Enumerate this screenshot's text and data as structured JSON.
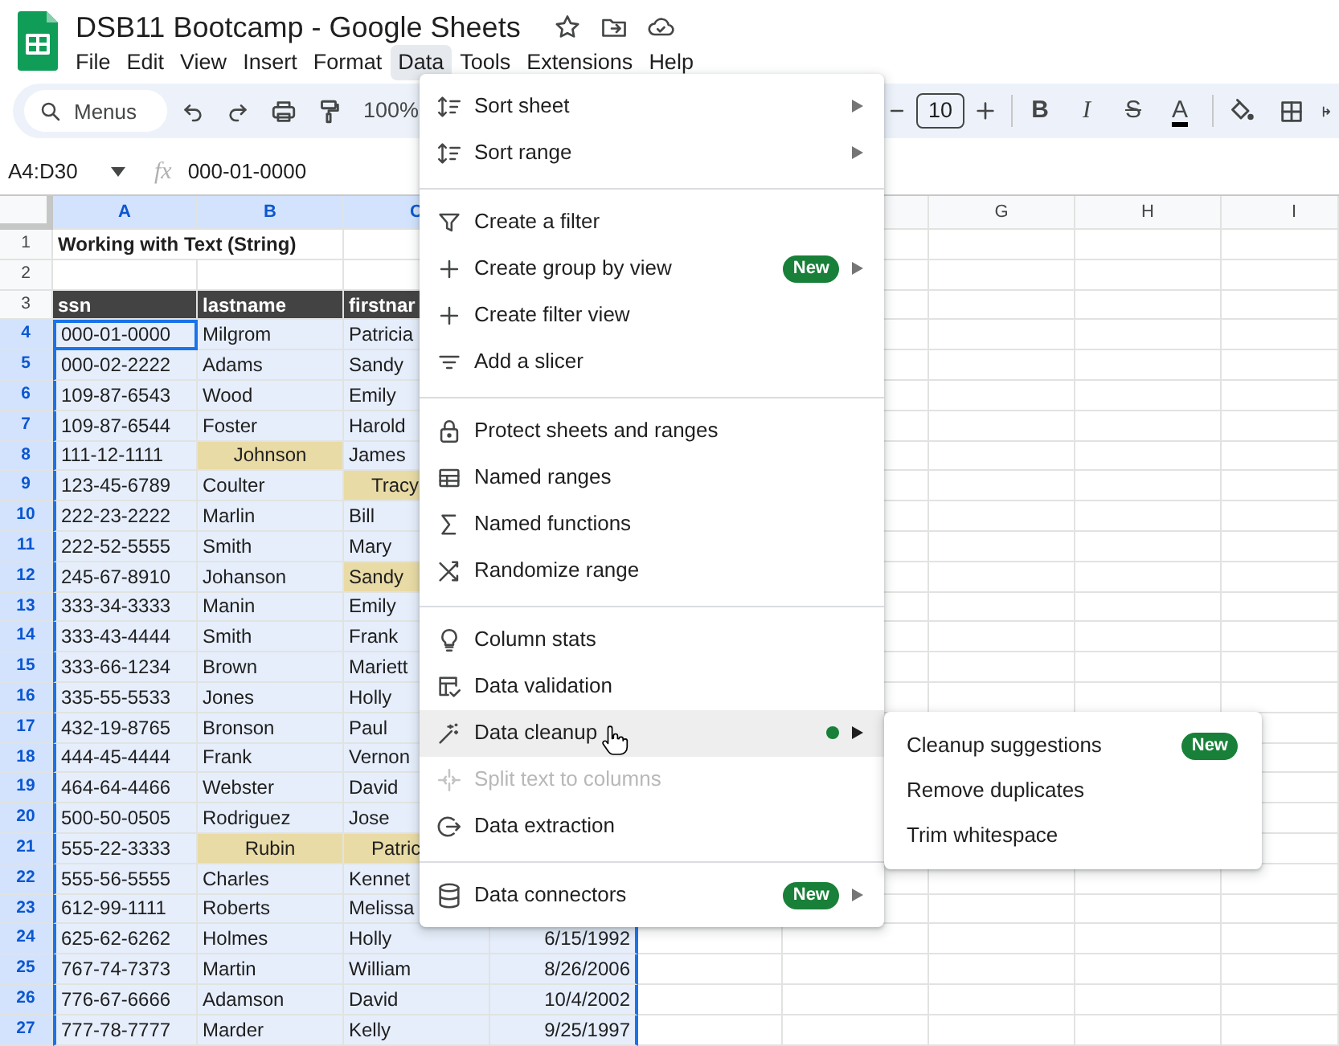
{
  "window": {
    "title": "DSB11 Bootcamp - Google Sheets"
  },
  "menu_bar": [
    {
      "label": "File",
      "selected": false
    },
    {
      "label": "Edit",
      "selected": false
    },
    {
      "label": "View",
      "selected": false
    },
    {
      "label": "Insert",
      "selected": false
    },
    {
      "label": "Format",
      "selected": false
    },
    {
      "label": "Data",
      "selected": true
    },
    {
      "label": "Tools",
      "selected": false
    },
    {
      "label": "Extensions",
      "selected": false
    },
    {
      "label": "Help",
      "selected": false
    }
  ],
  "toolbar": {
    "search": {
      "placeholder": "Menus"
    },
    "zoom": "100%",
    "font_size": "10",
    "format_buttons": [
      {
        "kind": "bold",
        "label": "B"
      },
      {
        "kind": "italic",
        "label": "I"
      },
      {
        "kind": "strikethrough",
        "label": "S"
      },
      {
        "kind": "text_color",
        "label": "A"
      }
    ]
  },
  "formula_bar": {
    "name_box": "A4:D30",
    "fx_label": "fx",
    "formula": "000-01-0000"
  },
  "sheet": {
    "columns": [
      {
        "label": "A",
        "selected": true
      },
      {
        "label": "B",
        "selected": true
      },
      {
        "label": "C",
        "selected": true
      },
      {
        "label": "G",
        "selected": false
      },
      {
        "label": "H",
        "selected": false
      },
      {
        "label": "I",
        "selected": false
      }
    ],
    "rows": [
      {
        "number": "1",
        "kind": "title",
        "selected": false,
        "cells": [
          {
            "text": "Working with Text (String)",
            "kind": "text"
          }
        ]
      },
      {
        "number": "2",
        "kind": "data",
        "selected": false
      },
      {
        "number": "3",
        "kind": "header",
        "selected": false,
        "cells": [
          {
            "text": "ssn",
            "kind": "text"
          },
          {
            "text": "lastname",
            "kind": "text"
          },
          {
            "text": "firstnar",
            "kind": "text"
          }
        ]
      },
      {
        "number": "4",
        "kind": "data",
        "selected": true,
        "cells": [
          {
            "text": "000-01-0000",
            "kind": "active"
          },
          {
            "text": "Milgrom",
            "kind": "text"
          },
          {
            "text": "Patricia",
            "kind": "text"
          }
        ]
      },
      {
        "number": "5",
        "kind": "data",
        "selected": true,
        "cells": [
          {
            "text": "000-02-2222",
            "kind": "text"
          },
          {
            "text": "Adams",
            "kind": "text"
          },
          {
            "text": "Sandy",
            "kind": "text"
          }
        ]
      },
      {
        "number": "6",
        "kind": "data",
        "selected": true,
        "cells": [
          {
            "text": "109-87-6543",
            "kind": "text"
          },
          {
            "text": "Wood",
            "kind": "text"
          },
          {
            "text": "Emily",
            "kind": "text"
          }
        ]
      },
      {
        "number": "7",
        "kind": "data",
        "selected": true,
        "cells": [
          {
            "text": "109-87-6544",
            "kind": "text"
          },
          {
            "text": "Foster",
            "kind": "text"
          },
          {
            "text": "Harold",
            "kind": "text"
          }
        ]
      },
      {
        "number": "8",
        "kind": "data",
        "selected": true,
        "cells": [
          {
            "text": "111-12-1111",
            "kind": "text"
          },
          {
            "text": "Johnson",
            "kind": "highlight_centered"
          },
          {
            "text": "James",
            "kind": "text"
          }
        ]
      },
      {
        "number": "9",
        "kind": "data",
        "selected": true,
        "cells": [
          {
            "text": "123-45-6789",
            "kind": "text"
          },
          {
            "text": "Coulter",
            "kind": "text"
          },
          {
            "text": "Tracy",
            "kind": "highlight_indented"
          }
        ]
      },
      {
        "number": "10",
        "kind": "data",
        "selected": true,
        "cells": [
          {
            "text": "222-23-2222",
            "kind": "text"
          },
          {
            "text": "Marlin",
            "kind": "text"
          },
          {
            "text": "Bill",
            "kind": "text"
          }
        ]
      },
      {
        "number": "11",
        "kind": "data",
        "selected": true,
        "cells": [
          {
            "text": "222-52-5555",
            "kind": "text"
          },
          {
            "text": "Smith",
            "kind": "text"
          },
          {
            "text": "Mary",
            "kind": "text"
          }
        ]
      },
      {
        "number": "12",
        "kind": "data",
        "selected": true,
        "cells": [
          {
            "text": "245-67-8910",
            "kind": "text"
          },
          {
            "text": "Johanson",
            "kind": "text"
          },
          {
            "text": "Sandy",
            "kind": "highlight"
          }
        ]
      },
      {
        "number": "13",
        "kind": "data",
        "selected": true,
        "cells": [
          {
            "text": "333-34-3333",
            "kind": "text"
          },
          {
            "text": "Manin",
            "kind": "text"
          },
          {
            "text": "Emily",
            "kind": "text"
          }
        ]
      },
      {
        "number": "14",
        "kind": "data",
        "selected": true,
        "cells": [
          {
            "text": "333-43-4444",
            "kind": "text"
          },
          {
            "text": "Smith",
            "kind": "text"
          },
          {
            "text": "Frank",
            "kind": "text"
          }
        ]
      },
      {
        "number": "15",
        "kind": "data",
        "selected": true,
        "cells": [
          {
            "text": "333-66-1234",
            "kind": "text"
          },
          {
            "text": "Brown",
            "kind": "text"
          },
          {
            "text": "Mariett",
            "kind": "text"
          }
        ]
      },
      {
        "number": "16",
        "kind": "data",
        "selected": true,
        "cells": [
          {
            "text": "335-55-5533",
            "kind": "text"
          },
          {
            "text": "Jones",
            "kind": "text"
          },
          {
            "text": "Holly",
            "kind": "text"
          }
        ]
      },
      {
        "number": "17",
        "kind": "data",
        "selected": true,
        "cells": [
          {
            "text": "432-19-8765",
            "kind": "text"
          },
          {
            "text": "Bronson",
            "kind": "text"
          },
          {
            "text": "Paul",
            "kind": "text"
          }
        ]
      },
      {
        "number": "18",
        "kind": "data",
        "selected": true,
        "cells": [
          {
            "text": "444-45-4444",
            "kind": "text"
          },
          {
            "text": "Frank",
            "kind": "text"
          },
          {
            "text": "Vernon",
            "kind": "text"
          }
        ]
      },
      {
        "number": "19",
        "kind": "data",
        "selected": true,
        "cells": [
          {
            "text": "464-64-4466",
            "kind": "text"
          },
          {
            "text": "Webster",
            "kind": "text"
          },
          {
            "text": "David",
            "kind": "text"
          }
        ]
      },
      {
        "number": "20",
        "kind": "data",
        "selected": true,
        "cells": [
          {
            "text": "500-50-0505",
            "kind": "text"
          },
          {
            "text": "Rodriguez",
            "kind": "text"
          },
          {
            "text": "Jose",
            "kind": "text"
          }
        ]
      },
      {
        "number": "21",
        "kind": "data",
        "selected": true,
        "cells": [
          {
            "text": "555-22-3333",
            "kind": "text"
          },
          {
            "text": "Rubin",
            "kind": "highlight_centered"
          },
          {
            "text": "Patric",
            "kind": "highlight_indented"
          }
        ]
      },
      {
        "number": "22",
        "kind": "data",
        "selected": true,
        "cells": [
          {
            "text": "555-56-5555",
            "kind": "text"
          },
          {
            "text": "Charles",
            "kind": "text"
          },
          {
            "text": "Kennet",
            "kind": "text"
          }
        ]
      },
      {
        "number": "23",
        "kind": "data",
        "selected": true,
        "cells": [
          {
            "text": "612-99-1111",
            "kind": "text"
          },
          {
            "text": "Roberts",
            "kind": "text"
          },
          {
            "text": "Melissa",
            "kind": "text"
          }
        ]
      },
      {
        "number": "24",
        "kind": "data",
        "selected": true,
        "cells": [
          {
            "text": "625-62-6262",
            "kind": "text"
          },
          {
            "text": "Holmes",
            "kind": "text"
          },
          {
            "text": "Holly",
            "kind": "text"
          },
          {
            "text": "6/15/1992",
            "kind": "date"
          }
        ]
      },
      {
        "number": "25",
        "kind": "data",
        "selected": true,
        "cells": [
          {
            "text": "767-74-7373",
            "kind": "text"
          },
          {
            "text": "Martin",
            "kind": "text"
          },
          {
            "text": "William",
            "kind": "text"
          },
          {
            "text": "8/26/2006",
            "kind": "date"
          }
        ]
      },
      {
        "number": "26",
        "kind": "data",
        "selected": true,
        "cells": [
          {
            "text": "776-67-6666",
            "kind": "text"
          },
          {
            "text": "Adamson",
            "kind": "text"
          },
          {
            "text": "David",
            "kind": "text"
          },
          {
            "text": "10/4/2002",
            "kind": "date"
          }
        ]
      },
      {
        "number": "27",
        "kind": "data",
        "selected": true,
        "cells": [
          {
            "text": "777-78-7777",
            "kind": "text"
          },
          {
            "text": "Marder",
            "kind": "text"
          },
          {
            "text": "Kelly",
            "kind": "text"
          },
          {
            "text": "9/25/1997",
            "kind": "date"
          }
        ]
      }
    ]
  },
  "data_menu": {
    "sections": [
      {
        "items": [
          {
            "label": "Sort sheet",
            "submenu": true,
            "dot": false,
            "disabled": false,
            "selected": false
          },
          {
            "label": "Sort range",
            "submenu": true,
            "dot": false,
            "disabled": false,
            "selected": false
          }
        ]
      },
      {
        "items": [
          {
            "label": "Create a filter",
            "submenu": false,
            "dot": false,
            "disabled": false,
            "selected": false
          },
          {
            "label": "Create group by view",
            "badge": "New",
            "submenu": true,
            "dot": false,
            "disabled": false,
            "selected": false
          },
          {
            "label": "Create filter view",
            "submenu": false,
            "dot": false,
            "disabled": false,
            "selected": false
          },
          {
            "label": "Add a slicer",
            "submenu": false,
            "dot": false,
            "disabled": false,
            "selected": false
          }
        ]
      },
      {
        "items": [
          {
            "label": "Protect sheets and ranges",
            "submenu": false,
            "dot": false,
            "disabled": false,
            "selected": false
          },
          {
            "label": "Named ranges",
            "submenu": false,
            "dot": false,
            "disabled": false,
            "selected": false
          },
          {
            "label": "Named functions",
            "submenu": false,
            "dot": false,
            "disabled": false,
            "selected": false
          },
          {
            "label": "Randomize range",
            "submenu": false,
            "dot": false,
            "disabled": false,
            "selected": false
          }
        ]
      },
      {
        "items": [
          {
            "label": "Column stats",
            "submenu": false,
            "dot": false,
            "disabled": false,
            "selected": false
          },
          {
            "label": "Data validation",
            "submenu": false,
            "dot": false,
            "disabled": false,
            "selected": false
          },
          {
            "label": "Data cleanup",
            "submenu": true,
            "dot": true,
            "disabled": false,
            "selected": true
          },
          {
            "label": "Split text to columns",
            "submenu": false,
            "dot": false,
            "disabled": true,
            "selected": false
          },
          {
            "label": "Data extraction",
            "submenu": false,
            "dot": false,
            "disabled": false,
            "selected": false
          }
        ]
      },
      {
        "items": [
          {
            "label": "Data connectors",
            "badge": "New",
            "submenu": true,
            "dot": false,
            "disabled": false,
            "selected": false
          }
        ]
      }
    ]
  },
  "cleanup_submenu": {
    "items": [
      {
        "label": "Cleanup suggestions",
        "badge": "New"
      },
      {
        "label": "Remove duplicates"
      },
      {
        "label": "Trim whitespace"
      }
    ]
  }
}
